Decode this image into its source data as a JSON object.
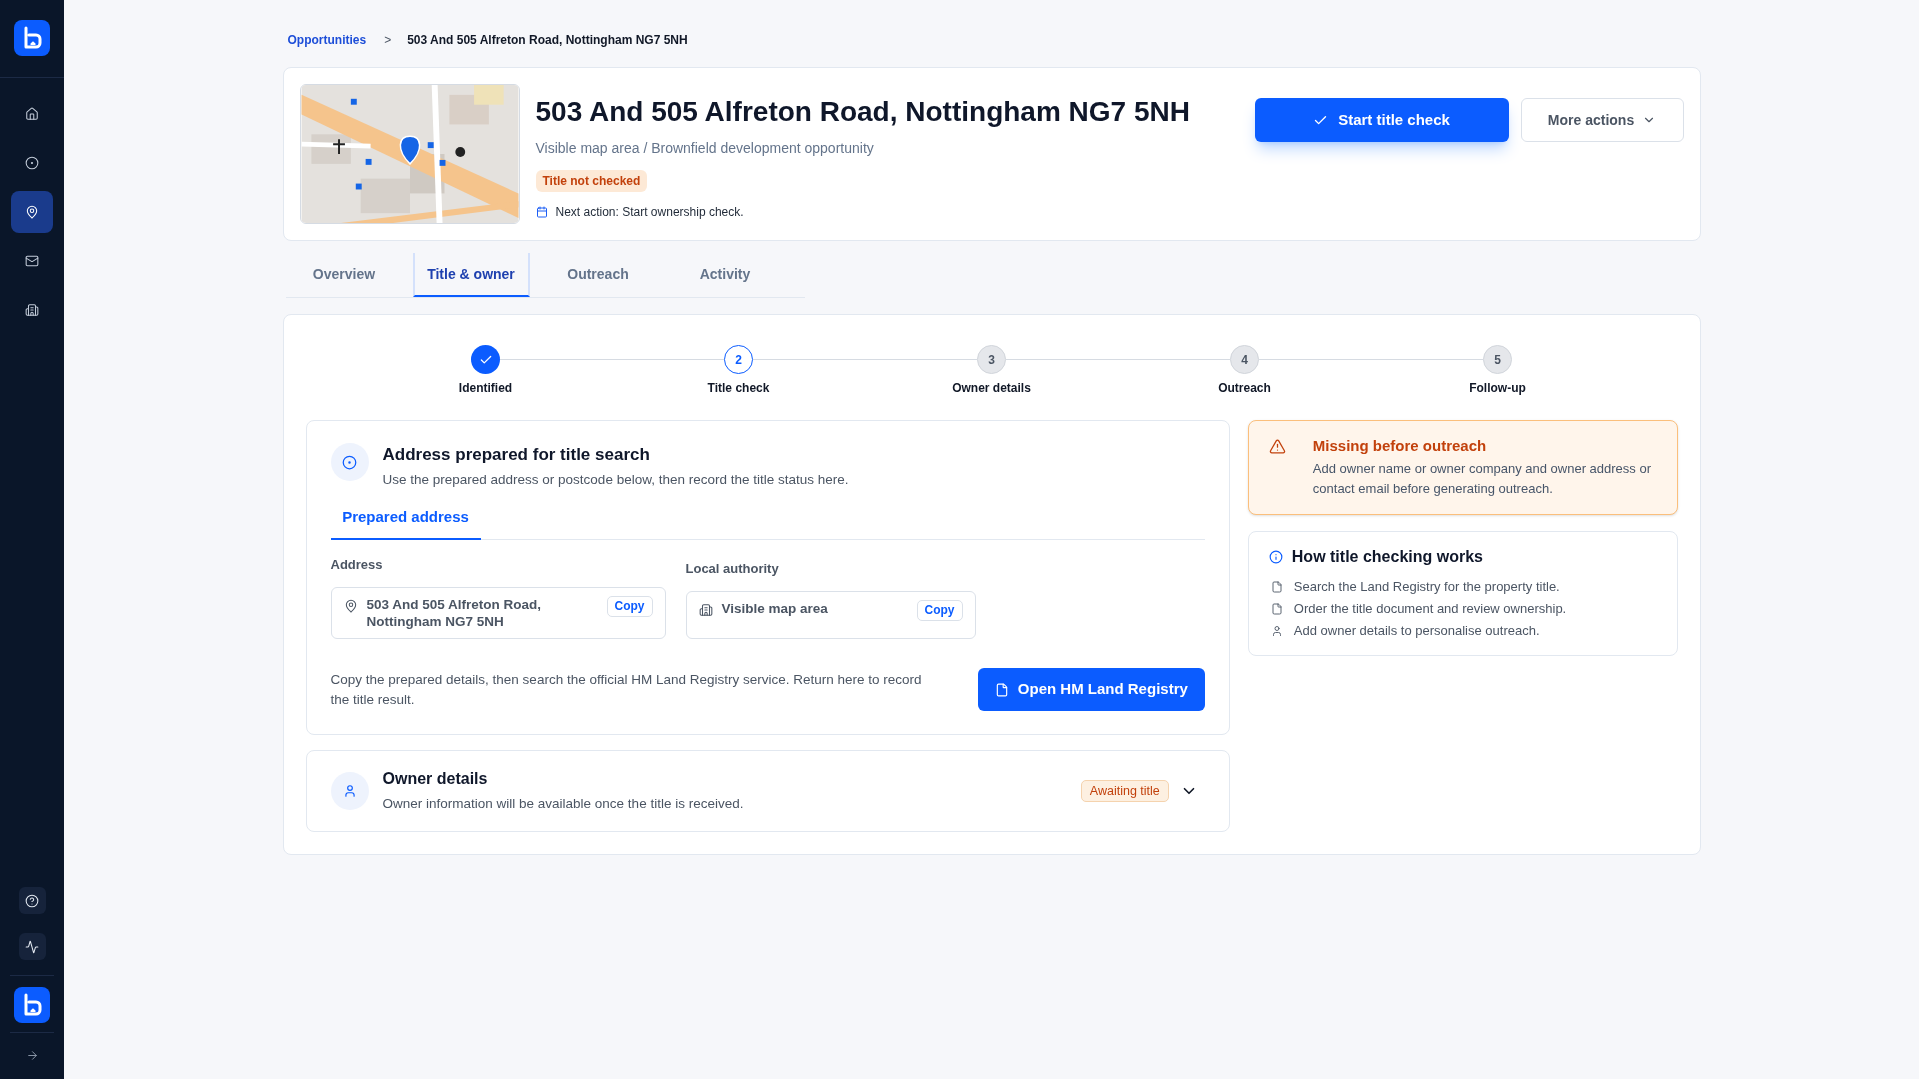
{
  "sidebar": {
    "nav_items": [
      {
        "selected": false
      },
      {
        "selected": false
      },
      {
        "selected": true
      },
      {
        "selected": false
      },
      {
        "selected": false
      }
    ]
  },
  "breadcrumb": {
    "parent": "Opportunities",
    "separator": ">",
    "current": "503 And 505 Alfreton Road, Nottingham NG7 5NH"
  },
  "header": {
    "title": "503 And 505 Alfreton Road, Nottingham NG7 5NH",
    "subtitle": "Visible map area / Brownfield development opportunity",
    "status_badge": "Title not checked",
    "next_action": "Next action: Start ownership check.",
    "primary_button": "Start title check",
    "secondary_button": "More actions"
  },
  "tabs": [
    {
      "label": "Overview",
      "selected": false
    },
    {
      "label": "Title & owner",
      "selected": true
    },
    {
      "label": "Outreach",
      "selected": false
    },
    {
      "label": "Activity",
      "selected": false
    }
  ],
  "stepper": {
    "steps": [
      {
        "label": "Identified",
        "completed": true,
        "selected": false
      },
      {
        "number": "2",
        "label": "Title check",
        "completed": false,
        "selected": true
      },
      {
        "number": "3",
        "label": "Owner details",
        "completed": false,
        "selected": false
      },
      {
        "number": "4",
        "label": "Outreach",
        "completed": false,
        "selected": false
      },
      {
        "number": "5",
        "label": "Follow-up",
        "completed": false,
        "selected": false
      }
    ]
  },
  "address_section": {
    "title": "Address prepared for title search",
    "description": "Use the prepared address or postcode below, then record the title status here.",
    "subtabs": [
      {
        "label": "Prepared address",
        "selected": true
      }
    ],
    "fields": [
      {
        "label": "Address",
        "value": "503 And 505 Alfreton Road, Nottingham NG7 5NH",
        "copy_button": "Copy"
      },
      {
        "label": "Local authority",
        "value": "Visible map area",
        "copy_button": "Copy"
      }
    ],
    "help_text": "Copy the prepared details, then search the official HM Land Registry service. Return here to record the title result.",
    "open_button": "Open HM Land Registry"
  },
  "owner_section": {
    "title": "Owner details",
    "description": "Owner information will be available once the title is received.",
    "status_badge": "Awaiting title",
    "expanded": false
  },
  "warning": {
    "title": "Missing before outreach",
    "message": "Add owner name or owner company and owner address or contact email before generating outreach."
  },
  "how_it_works": {
    "title": "How title checking works",
    "steps": [
      "Search the Land Registry for the property title.",
      "Order the title document and review ownership.",
      "Add owner details to personalise outreach."
    ]
  }
}
